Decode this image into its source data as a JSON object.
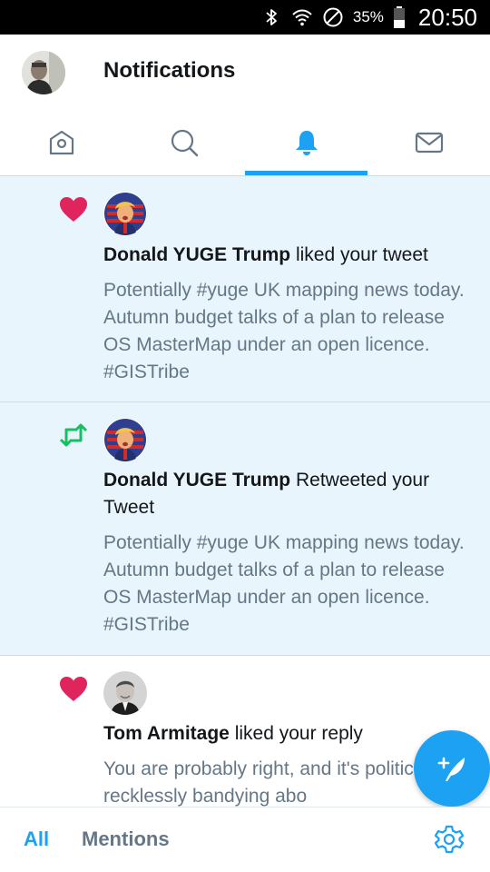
{
  "status_bar": {
    "battery_percent": "35%",
    "time": "20:50",
    "icons": [
      "bluetooth-icon",
      "wifi-icon",
      "do-not-disturb-icon",
      "battery-icon"
    ]
  },
  "header": {
    "title": "Notifications",
    "avatar_icon": "profile-avatar"
  },
  "tabs": [
    {
      "name": "home",
      "icon": "home-icon",
      "active": false
    },
    {
      "name": "search",
      "icon": "search-icon",
      "active": false
    },
    {
      "name": "notifications",
      "icon": "bell-icon",
      "active": true
    },
    {
      "name": "messages",
      "icon": "mail-icon",
      "active": false
    }
  ],
  "colors": {
    "accent": "#1da1f2",
    "like": "#e0245e",
    "retweet": "#17bf63",
    "unread_bg": "#e8f5fd",
    "secondary_text": "#657786"
  },
  "notifications": [
    {
      "type": "like",
      "icon": "heart-icon",
      "unread": true,
      "actor": "Donald YUGE Trump",
      "action": " liked your tweet",
      "tweet_text": "Potentially #yuge UK mapping news today. Autumn budget talks of a plan to release OS MasterMap under an open licence. #GISTribe"
    },
    {
      "type": "retweet",
      "icon": "retweet-icon",
      "unread": true,
      "actor": "Donald YUGE Trump",
      "action": " Retweeted your Tweet",
      "tweet_text": "Potentially #yuge UK mapping news today. Autumn budget talks of a plan to release OS MasterMap under an open licence. #GISTribe"
    },
    {
      "type": "like",
      "icon": "heart-icon",
      "unread": false,
      "actor": "Tom Armitage",
      "action": " liked your reply",
      "tweet_text": "You are probably right, and it's politicians recklessly bandying abo"
    }
  ],
  "fab": {
    "icon": "compose-tweet-icon"
  },
  "bottom_bar": {
    "all_label": "All",
    "mentions_label": "Mentions",
    "settings_icon": "gear-icon"
  }
}
